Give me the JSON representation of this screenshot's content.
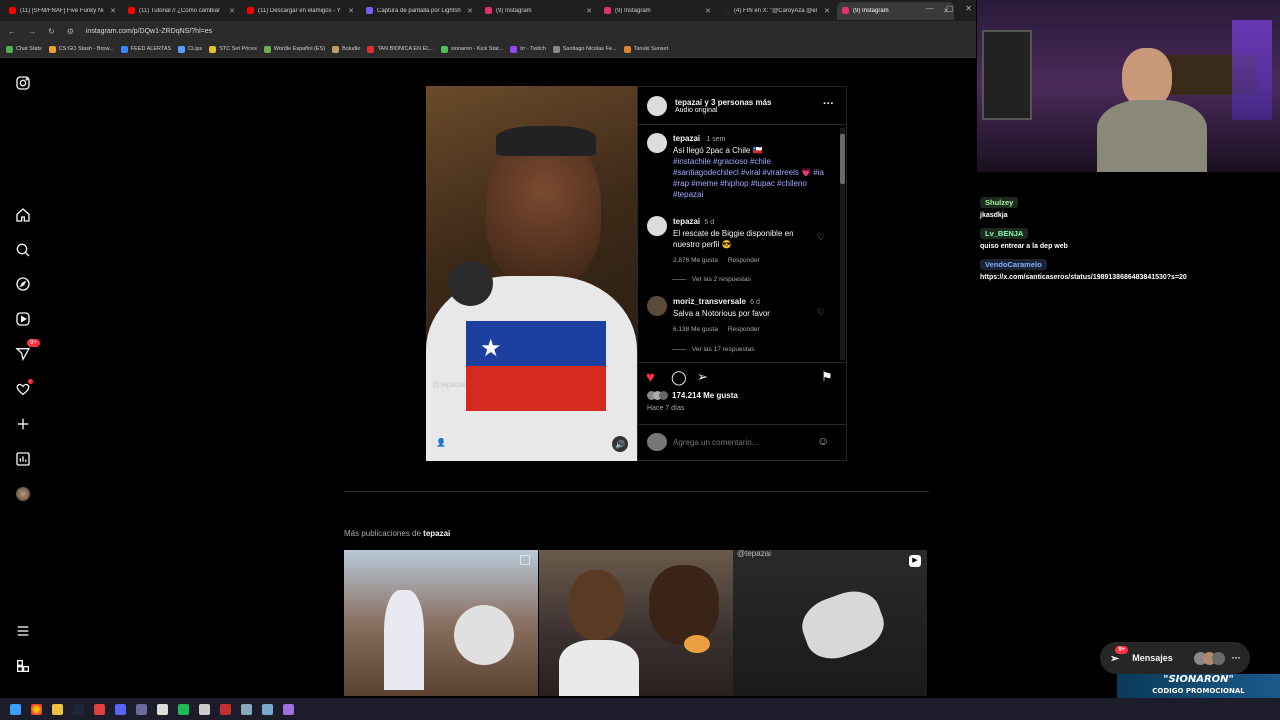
{
  "browser": {
    "tabs": [
      {
        "label": "(11) [SFM/FNAF] Five Funky Ni",
        "color": "#ff0000"
      },
      {
        "label": "(11) Tutorial // ¿Cómo cambiar",
        "color": "#ff0000"
      },
      {
        "label": "(11) Descargar en elamigos - Y",
        "color": "#ff0000"
      },
      {
        "label": "Captura de pantalla por Lightsh",
        "color": "#7b5cff"
      },
      {
        "label": "(9) Instagram",
        "color": "#e1306c"
      },
      {
        "label": "(9) Instagram",
        "color": "#e1306c"
      },
      {
        "label": "(4) FIN en X: \"@CaroyAza @el",
        "color": "#222222"
      },
      {
        "label": "(9) Instagram",
        "color": "#e1306c"
      }
    ],
    "url": "instagram.com/p/DQw1-ZRDqNS/?hl=es",
    "bookmarks": [
      "Chat Stats",
      "CS:GO Stash - Brow...",
      "FEED ALERTAS",
      "CLips",
      "STC Set Prices",
      "Wordle Español (ES)",
      "Boludle",
      "TAN BIONICA EN EL...",
      "sionaron - Kick Stat...",
      "trr - Twitch",
      "Santiago Nicolas Fe...",
      "Tanuki Sunset"
    ]
  },
  "sidebar": {
    "notif_badge": "9+"
  },
  "post": {
    "header_user": "tepazai y 3 personas más",
    "header_audio": "Audio original",
    "caption_user": "tepazai",
    "caption_time": "1 sem",
    "caption_text": "Así llegó 2pac a Chile 🇨🇱",
    "caption_tags": "#instachile #gracioso #chile #santiagodechilecl #viral #viralreels 💗 #ia #rap #meme #hiphop #tupac #chileno #tepazai",
    "comments": [
      {
        "user": "tepazai",
        "time": "5 d",
        "text": "El rescate de Biggie disponible en nuestro perfil 😎",
        "likes": "2.876 Me gusta",
        "reply": "Responder",
        "replies": "Ver las 2 respuestas"
      },
      {
        "user": "moriz_transversale",
        "time": "6 d",
        "text": "Salva a Notorious por favor",
        "likes": "6.138 Me gusta",
        "reply": "Responder",
        "replies": "Ver las 17 respuestas"
      }
    ],
    "likes": "174.214 Me gusta",
    "date": "Hace 7 días",
    "comment_placeholder": "Agrega un comentario...",
    "watermark": "@tepazai"
  },
  "more": {
    "prefix": "Más publicaciones de ",
    "user": "tepazai",
    "thumb_watermark": "@tepazai"
  },
  "chat": [
    {
      "user": "Shulzey",
      "color": "#a5f0a5",
      "msg": "jkasdkja"
    },
    {
      "user": "Lv_BENJA",
      "color": "#7dffb0",
      "msg": "quiso entrear a la dep web"
    },
    {
      "user": "VendoCaramelo",
      "color": "#7fb0ff",
      "msg": "https://x.com/santicaseros/status/1989138686483841530?s=20"
    }
  ],
  "messages": {
    "label": "Mensajes",
    "badge": "9+"
  },
  "promo": {
    "name": "\"SIONARON\"",
    "sub": "CODIGO PROMOCIONAL"
  }
}
